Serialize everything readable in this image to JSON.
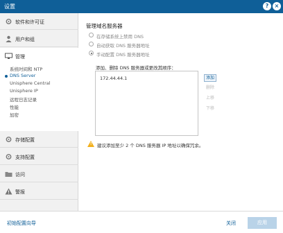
{
  "window": {
    "title": "设置",
    "help_glyph": "?",
    "close_glyph": "×"
  },
  "sidebar": {
    "sections": [
      {
        "label": "软件和许可证",
        "icon": "gear-icon"
      },
      {
        "label": "用户和组",
        "icon": "user-icon"
      },
      {
        "label": "管理",
        "icon": "monitor-icon"
      },
      {
        "label": "存储配置",
        "icon": "storage-gear-icon"
      },
      {
        "label": "支持配置",
        "icon": "support-gear-icon"
      },
      {
        "label": "访问",
        "icon": "folder-icon"
      },
      {
        "label": "警报",
        "icon": "alert-icon"
      }
    ],
    "management_items": [
      {
        "label": "系统时间和 NTP",
        "active": false
      },
      {
        "label": "DNS Server",
        "active": true
      },
      {
        "label": "Unisphere Central",
        "active": false
      },
      {
        "label": "Unisphere IP",
        "active": false
      },
      {
        "label": "远程日志记录",
        "active": false
      },
      {
        "label": "性能",
        "active": false
      },
      {
        "label": "加密",
        "active": false
      }
    ]
  },
  "main": {
    "title": "管理域名服务器",
    "radio_options": [
      {
        "label": "在存储系统上禁用 DNS",
        "checked": false
      },
      {
        "label": "自动获取 DNS 服务器地址",
        "checked": false
      },
      {
        "label": "手动配置 DNS 服务器地址",
        "checked": true
      }
    ],
    "dns_list_label": "添加、删除 DNS 服务器或更改其顺序：",
    "dns_entries": [
      "172.44.44.1"
    ],
    "buttons": {
      "add": "添加",
      "remove": "删除",
      "up": "上移",
      "down": "下移"
    },
    "warning": "建议添加至少 2 个 DNS 服务器 IP 地址以确保冗余。"
  },
  "footer": {
    "wizard": "初始配置向导",
    "close": "关闭",
    "apply": "应用"
  }
}
